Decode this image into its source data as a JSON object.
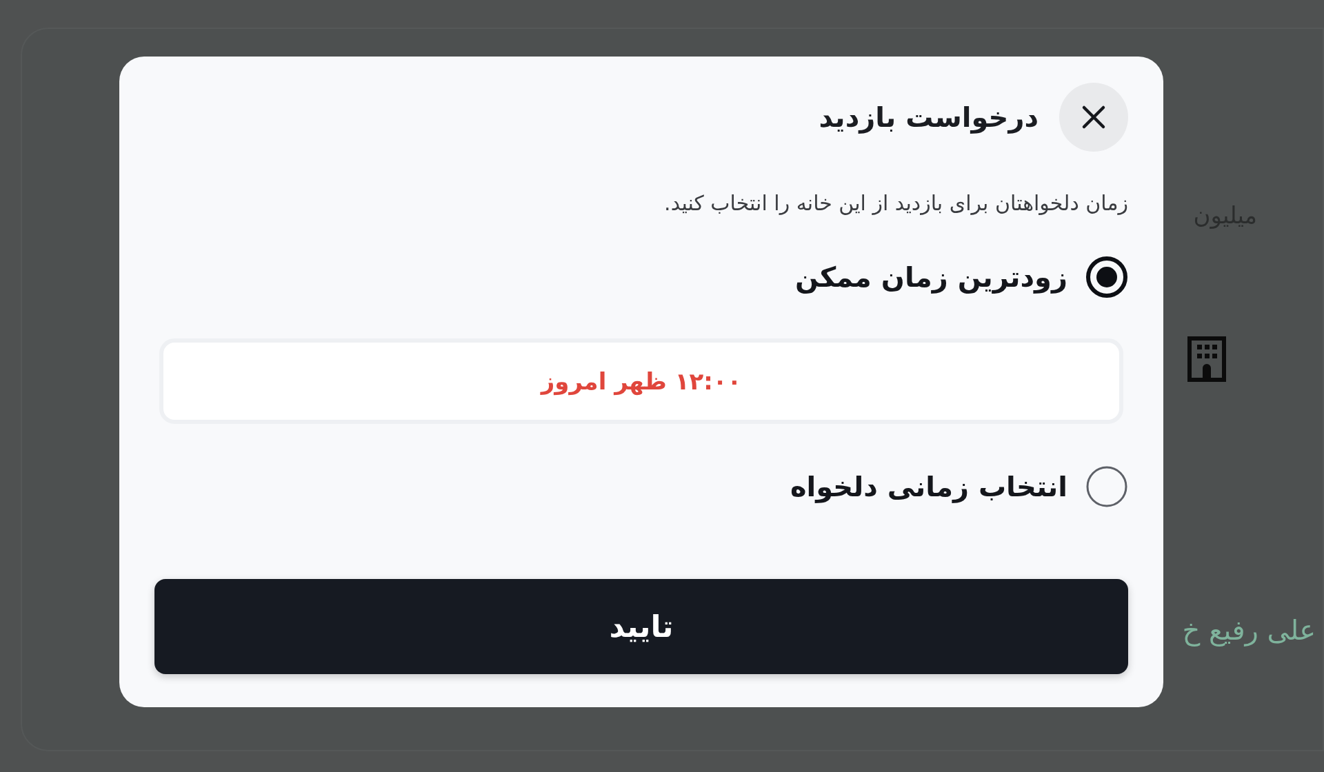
{
  "background": {
    "price_unit": "میلیون",
    "agent_name": "علی رفیع خ"
  },
  "modal": {
    "title": "درخواست بازدید",
    "subtitle": "زمان دلخواهتان برای بازدید از این خانه را انتخاب کنید.",
    "options": [
      {
        "label": "زودترین زمان ممکن",
        "selected": true,
        "time": "۱۲:۰۰ ظهر امروز"
      },
      {
        "label": "انتخاب زمانی دلخواه",
        "selected": false
      }
    ],
    "confirm_button": "تایید"
  }
}
